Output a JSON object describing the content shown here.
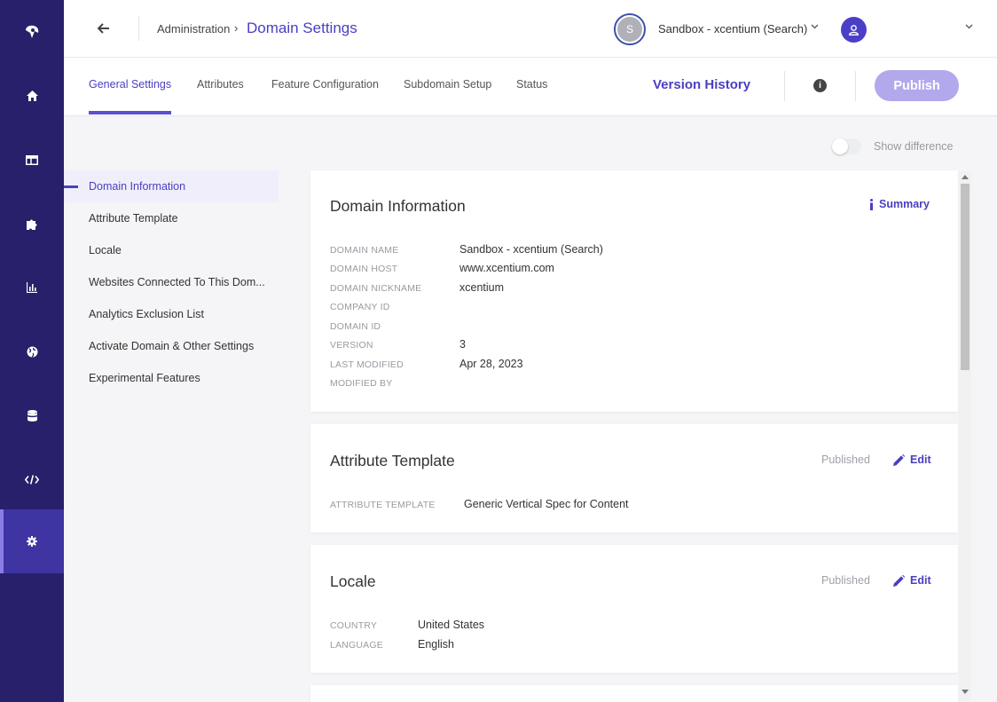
{
  "nav": {
    "items": [
      {
        "icon": "home-icon"
      },
      {
        "icon": "layout-icon"
      },
      {
        "icon": "puzzle-icon"
      },
      {
        "icon": "bar-chart-icon"
      },
      {
        "icon": "globe-icon"
      },
      {
        "icon": "database-icon"
      },
      {
        "icon": "code-icon"
      },
      {
        "icon": "gear-icon",
        "active": true
      }
    ]
  },
  "header": {
    "breadcrumb_parent": "Administration",
    "breadcrumb_sep": "›",
    "page_title": "Domain Settings",
    "site_initial": "S",
    "site_name": "Sandbox - xcentium (Search)"
  },
  "tabs": {
    "items": [
      "General Settings",
      "Attributes",
      "Feature Configuration",
      "Subdomain Setup",
      "Status"
    ],
    "active": "General Settings",
    "version_history": "Version History",
    "info": "i",
    "publish": "Publish"
  },
  "toggle": {
    "label": "Show difference",
    "on": false
  },
  "section_nav": {
    "items": [
      "Domain Information",
      "Attribute Template",
      "Locale",
      "Websites Connected To This Dom...",
      "Analytics Exclusion List",
      "Activate Domain & Other Settings",
      "Experimental Features"
    ],
    "active": "Domain Information"
  },
  "domain_info": {
    "title": "Domain Information",
    "summary": "Summary",
    "fields": [
      {
        "key": "DOMAIN NAME",
        "value": "Sandbox - xcentium (Search)"
      },
      {
        "key": "DOMAIN HOST",
        "value": "www.xcentium.com"
      },
      {
        "key": "DOMAIN NICKNAME",
        "value": "xcentium"
      },
      {
        "key": "COMPANY ID",
        "value": ""
      },
      {
        "key": "DOMAIN ID",
        "value": ""
      },
      {
        "key": "VERSION",
        "value": "3"
      },
      {
        "key": "LAST MODIFIED",
        "value": "Apr 28, 2023"
      },
      {
        "key": "MODIFIED BY",
        "value": ""
      }
    ]
  },
  "attribute_template": {
    "title": "Attribute Template",
    "status": "Published",
    "edit": "Edit",
    "key": "ATTRIBUTE TEMPLATE",
    "value": "Generic Vertical Spec for Content"
  },
  "locale": {
    "title": "Locale",
    "status": "Published",
    "edit": "Edit",
    "fields": [
      {
        "key": "COUNTRY",
        "value": "United States"
      },
      {
        "key": "LANGUAGE",
        "value": "English"
      }
    ]
  },
  "colors": {
    "rail": "#28206b",
    "rail_active": "#3e34a2",
    "accent": "#4a3fc0",
    "publish_disabled": "#b2a8ec"
  }
}
